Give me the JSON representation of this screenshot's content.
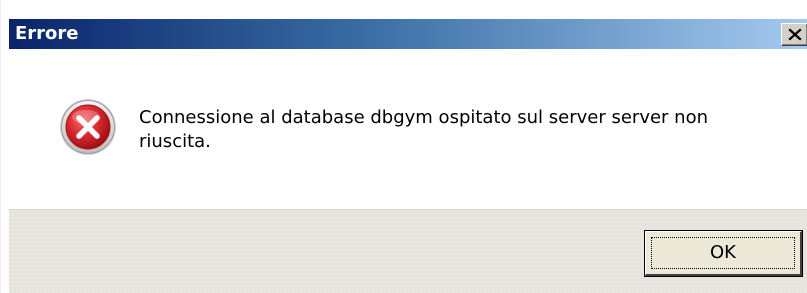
{
  "dialog": {
    "title": "Errore",
    "message": "Connessione al database dbgym ospitato sul server server non riuscita.",
    "icon": "error-icon",
    "close_icon": "close-icon",
    "ok_label": "OK"
  },
  "colors": {
    "titlebar_start": "#0a246a",
    "titlebar_end": "#a6caf0",
    "error_red": "#d8292f",
    "button_face": "#ece9d8"
  }
}
